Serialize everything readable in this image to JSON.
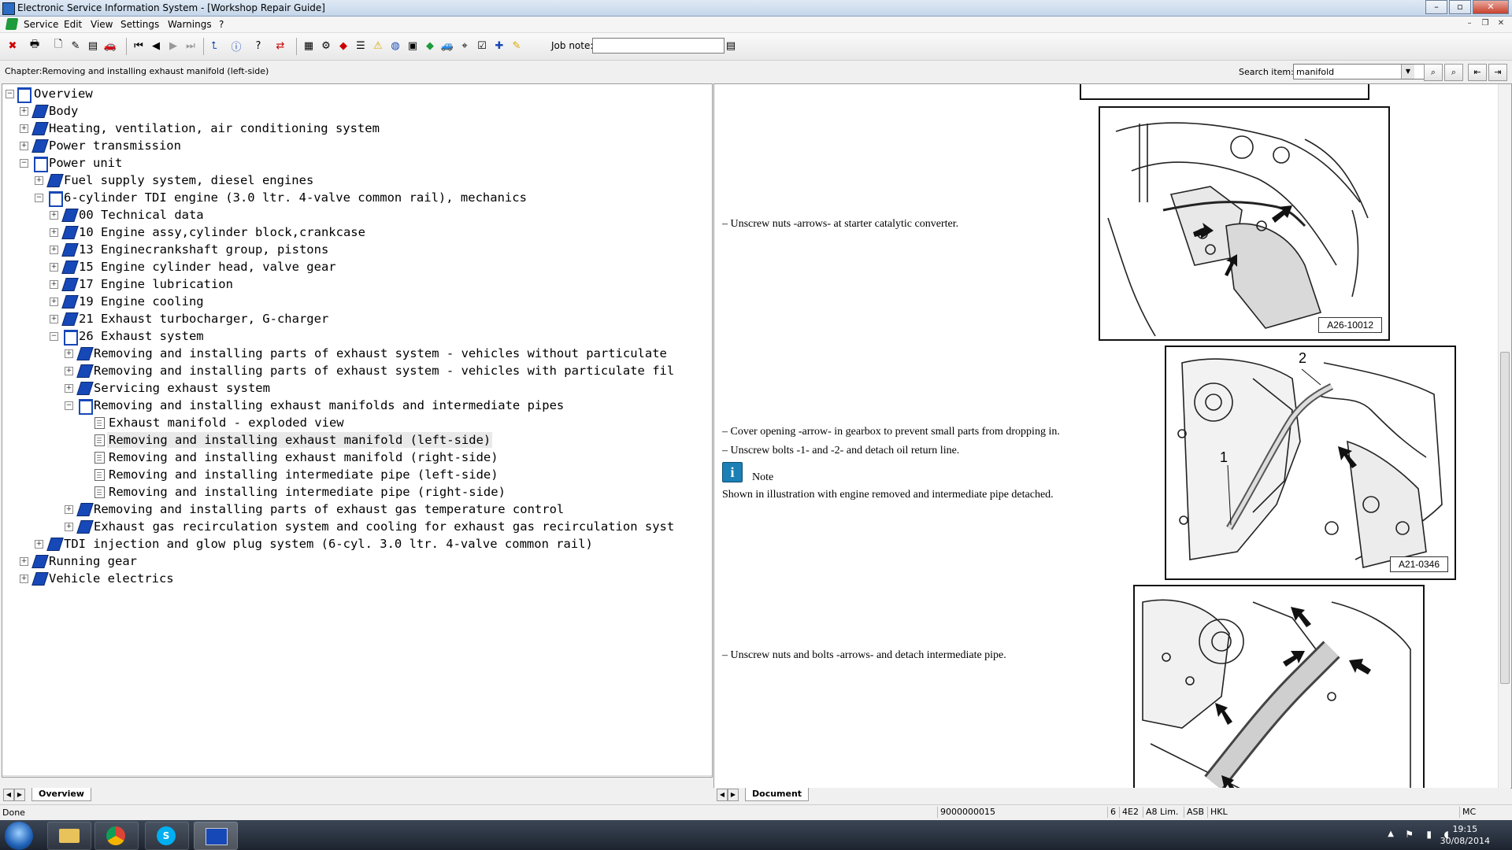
{
  "window": {
    "title": "Electronic Service Information System - [Workshop Repair Guide]"
  },
  "menu": {
    "items": [
      "Service",
      "Edit",
      "View",
      "Settings",
      "Warnings",
      "?"
    ]
  },
  "toolbar": {
    "job_note_label": "Job note:",
    "job_note_value": ""
  },
  "chapter": {
    "text": "Chapter:Removing and installing exhaust manifold (left-side)"
  },
  "search": {
    "label": "Search item:",
    "value": "manifold"
  },
  "tree": {
    "items": [
      {
        "label": "Overview"
      },
      {
        "label": "Body"
      },
      {
        "label": "Heating, ventilation, air conditioning system"
      },
      {
        "label": "Power transmission"
      },
      {
        "label": "Power unit"
      },
      {
        "label": "Fuel supply system, diesel engines"
      },
      {
        "label": "6-cylinder TDI engine (3.0 ltr. 4-valve common rail), mechanics"
      },
      {
        "label": "00 Technical data"
      },
      {
        "label": "10 Engine assy,cylinder block,crankcase"
      },
      {
        "label": "13 Enginecrankshaft group, pistons"
      },
      {
        "label": "15 Engine cylinder head, valve gear"
      },
      {
        "label": "17 Engine lubrication"
      },
      {
        "label": "19 Engine cooling"
      },
      {
        "label": "21 Exhaust turbocharger, G-charger"
      },
      {
        "label": "26 Exhaust system"
      },
      {
        "label": "Removing and installing parts of exhaust system - vehicles without particulate"
      },
      {
        "label": "Removing and installing parts of exhaust system - vehicles with particulate fil"
      },
      {
        "label": "Servicing exhaust system"
      },
      {
        "label": "Removing and installing exhaust manifolds and intermediate pipes"
      },
      {
        "label": "Exhaust manifold - exploded view"
      },
      {
        "label": "Removing and installing exhaust manifold (left-side)"
      },
      {
        "label": "Removing and installing exhaust manifold (right-side)"
      },
      {
        "label": "Removing and installing intermediate pipe (left-side)"
      },
      {
        "label": "Removing and installing intermediate pipe (right-side)"
      },
      {
        "label": "Removing and installing parts of exhaust gas temperature control"
      },
      {
        "label": "Exhaust gas recirculation system and cooling for exhaust gas recirculation syst"
      },
      {
        "label": "TDI injection and glow plug system (6-cyl. 3.0 ltr. 4-valve common rail)"
      },
      {
        "label": "Running gear"
      },
      {
        "label": "Vehicle electrics"
      }
    ]
  },
  "tabs": {
    "left": "Overview",
    "right": "Document"
  },
  "document": {
    "steps": [
      "–  Unscrew nuts -arrows- at starter catalytic converter.",
      "–  Cover opening -arrow- in gearbox to prevent small parts from dropping in.",
      "–  Unscrew bolts -1- and -2- and detach oil return line.",
      "–  Unscrew nuts and bolts -arrows- and detach intermediate pipe."
    ],
    "note_title": "Note",
    "note_text": "Shown in illustration with engine removed and intermediate pipe detached.",
    "figures": [
      {
        "code": "A26-10012"
      },
      {
        "code": "A21-0346",
        "callouts": [
          "1",
          "2"
        ]
      },
      {
        "code": ""
      }
    ]
  },
  "status": {
    "left": "Done",
    "cells": [
      "9000000015",
      "6",
      "4E2",
      "A8 Lim.",
      "ASB",
      "HKL",
      "MC"
    ]
  },
  "clock": {
    "time": "19:15",
    "date": "30/08/2014"
  },
  "colors": {
    "book_blue": "#1748b8",
    "info_blue": "#1c7fb5",
    "taskbar": "#1d2430"
  }
}
